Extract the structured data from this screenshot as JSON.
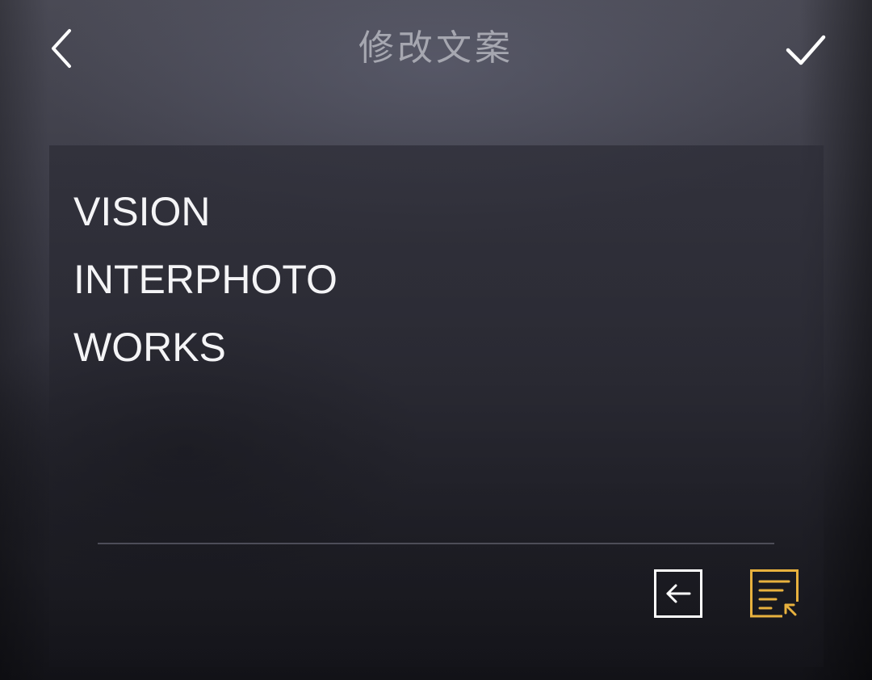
{
  "header": {
    "title": "修改文案",
    "back_icon": "chevron-left-icon",
    "confirm_icon": "checkmark-icon"
  },
  "editor": {
    "lines": [
      "VISION",
      "INTERPHOTO",
      "WORKS"
    ]
  },
  "toolbar": {
    "clear_icon": "backspace-arrow-icon",
    "format_icon": "text-format-icon"
  },
  "colors": {
    "text": "#f4f4f6",
    "title": "#a6a7b0",
    "accent": "#e8b13e",
    "icon": "#ffffff"
  }
}
